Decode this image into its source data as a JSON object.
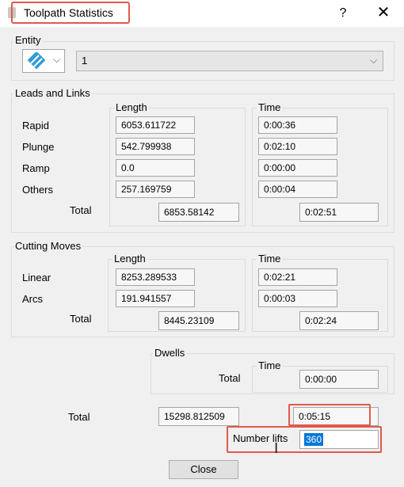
{
  "window": {
    "title": "Toolpath Statistics",
    "help": "?",
    "close": "✕"
  },
  "entity": {
    "label": "Entity",
    "icon": "toolpath-icon",
    "dropdown_value": "1"
  },
  "leads_links": {
    "title": "Leads and Links",
    "length_header": "Length",
    "time_header": "Time",
    "rows": [
      {
        "label": "Rapid",
        "length": "6053.611722",
        "time": "0:00:36"
      },
      {
        "label": "Plunge",
        "length": "542.799938",
        "time": "0:02:10"
      },
      {
        "label": "Ramp",
        "length": "0.0",
        "time": "0:00:00"
      },
      {
        "label": "Others",
        "length": "257.169759",
        "time": "0:00:04"
      }
    ],
    "total_label": "Total",
    "total_length": "6853.58142",
    "total_time": "0:02:51"
  },
  "cutting": {
    "title": "Cutting Moves",
    "length_header": "Length",
    "time_header": "Time",
    "rows": [
      {
        "label": "Linear",
        "length": "8253.289533",
        "time": "0:02:21"
      },
      {
        "label": "Arcs",
        "length": "191.941557",
        "time": "0:00:03"
      }
    ],
    "total_label": "Total",
    "total_length": "8445.23109",
    "total_time": "0:02:24"
  },
  "dwells": {
    "title": "Dwells",
    "time_header": "Time",
    "total_label": "Total",
    "total_time": "0:00:00"
  },
  "grand_total": {
    "label": "Total",
    "length": "15298.812509",
    "time": "0:05:15"
  },
  "lifts": {
    "label": "Number lifts",
    "value": "360"
  },
  "close_button": "Close",
  "colors": {
    "highlight": "#e05a4a",
    "selection": "#0078d7"
  }
}
